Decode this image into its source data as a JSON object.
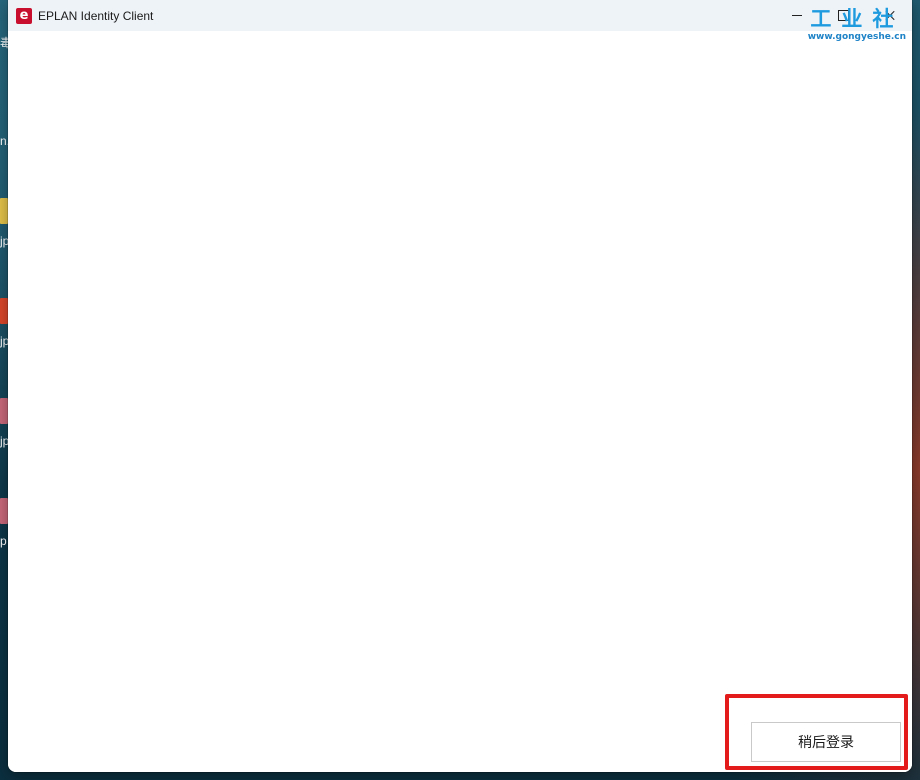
{
  "window": {
    "title": "EPLAN Identity Client",
    "app_icon_letter": "e",
    "controls": {
      "minimize": "minimize-icon",
      "maximize": "maximize-icon",
      "close": "close-icon"
    }
  },
  "actions": {
    "login_later_label": "稍后登录"
  },
  "watermark": {
    "logo_text": "工业社",
    "url": "www.gongyeshe.cn"
  },
  "desktop_fragments": [
    "毒",
    "n.",
    "jp",
    "jp",
    "jp",
    "p"
  ],
  "colors": {
    "titlebar": "#eef3f8",
    "app_icon": "#c8102e",
    "highlight": "#e31b1b",
    "watermark": "#1e9adf"
  }
}
